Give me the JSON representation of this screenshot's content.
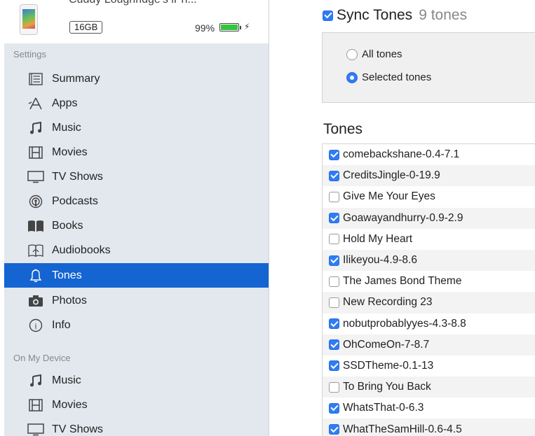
{
  "device": {
    "name": "Cuddy Loughridge's iPh...",
    "capacity": "16GB",
    "battery_percent": "99%",
    "battery_level": 0.99,
    "charging_symbol": "⚡"
  },
  "sidebar": {
    "settings_heading": "Settings",
    "settings_items": [
      {
        "label": "Summary",
        "icon": "summary-icon"
      },
      {
        "label": "Apps",
        "icon": "apps-icon"
      },
      {
        "label": "Music",
        "icon": "music-icon"
      },
      {
        "label": "Movies",
        "icon": "movies-icon"
      },
      {
        "label": "TV Shows",
        "icon": "tv-icon"
      },
      {
        "label": "Podcasts",
        "icon": "podcasts-icon"
      },
      {
        "label": "Books",
        "icon": "books-icon"
      },
      {
        "label": "Audiobooks",
        "icon": "audiobooks-icon"
      },
      {
        "label": "Tones",
        "icon": "bell-icon",
        "selected": true
      },
      {
        "label": "Photos",
        "icon": "camera-icon"
      },
      {
        "label": "Info",
        "icon": "info-icon"
      }
    ],
    "device_heading": "On My Device",
    "device_items": [
      {
        "label": "Music",
        "icon": "music-icon"
      },
      {
        "label": "Movies",
        "icon": "movies-icon"
      },
      {
        "label": "TV Shows",
        "icon": "tv-icon"
      }
    ]
  },
  "main": {
    "sync_label": "Sync Tones",
    "sync_count": "9 tones",
    "sync_checked": true,
    "options": {
      "all_label": "All tones",
      "selected_label": "Selected tones",
      "selected": "selected"
    },
    "tones_heading": "Tones",
    "tones": [
      {
        "name": "comebackshane-0.4-7.1",
        "checked": true
      },
      {
        "name": "CreditsJingle-0-19.9",
        "checked": true
      },
      {
        "name": "Give Me Your Eyes",
        "checked": false
      },
      {
        "name": "Goawayandhurry-0.9-2.9",
        "checked": true
      },
      {
        "name": "Hold My Heart",
        "checked": false
      },
      {
        "name": "Ilikeyou-4.9-8.6",
        "checked": true
      },
      {
        "name": "The James Bond Theme",
        "checked": false
      },
      {
        "name": "New Recording 23",
        "checked": false
      },
      {
        "name": "nobutprobablyyes-4.3-8.8",
        "checked": true
      },
      {
        "name": "OhComeOn-7-8.7",
        "checked": true
      },
      {
        "name": "SSDTheme-0.1-13",
        "checked": true
      },
      {
        "name": "To Bring You Back",
        "checked": false
      },
      {
        "name": "WhatsThat-0-6.3",
        "checked": true
      },
      {
        "name": "WhatTheSamHill-0.6-4.5",
        "checked": true
      }
    ]
  },
  "colors": {
    "accent": "#1464d2",
    "checkbox_blue": "#2e7cf6",
    "sidebar_bg": "#e3e8ef",
    "battery_green": "#34c53d"
  }
}
